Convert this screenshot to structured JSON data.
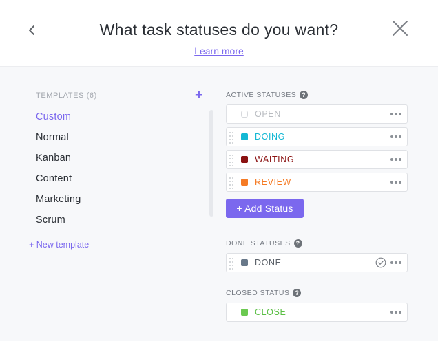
{
  "header": {
    "title": "What task statuses do you want?",
    "learn_more": "Learn more"
  },
  "templates": {
    "heading": "TEMPLATES (6)",
    "items": [
      "Custom",
      "Normal",
      "Kanban",
      "Content",
      "Marketing",
      "Scrum"
    ],
    "selected": "Custom",
    "new_template": "+ New template"
  },
  "active_statuses": {
    "heading": "ACTIVE STATUSES",
    "items": [
      {
        "name": "OPEN",
        "color": "#ffffff",
        "text_color": "#b9bcc1"
      },
      {
        "name": "DOING",
        "color": "#14b8d4",
        "text_color": "#14b8d4"
      },
      {
        "name": "WAITING",
        "color": "#8b1212",
        "text_color": "#8b1212"
      },
      {
        "name": "REVIEW",
        "color": "#f57b25",
        "text_color": "#f57b25"
      }
    ],
    "add_status": "+ Add Status"
  },
  "done_statuses": {
    "heading": "DONE STATUSES",
    "items": [
      {
        "name": "DONE",
        "color": "#687889",
        "text_color": "#5b6169"
      }
    ]
  },
  "closed_status": {
    "heading": "CLOSED STATUS",
    "items": [
      {
        "name": "CLOSE",
        "color": "#6bc950",
        "text_color": "#5bbf45"
      }
    ]
  },
  "colors": {
    "accent": "#7b68ee"
  }
}
